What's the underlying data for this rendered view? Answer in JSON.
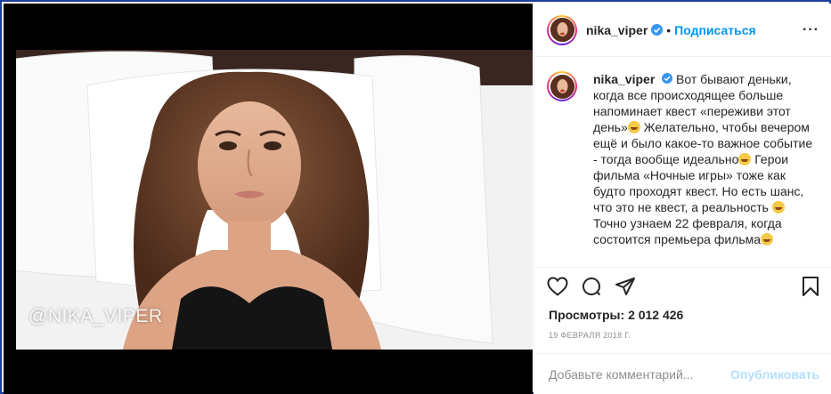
{
  "post": {
    "username": "nika_viper",
    "follow_label": "Подписаться",
    "separator": "•",
    "more_label": "···",
    "watermark": "@NIKA_VIPER",
    "caption_parts": [
      "Вот бывают деньки, когда все происходящее больше напоминает квест «переживи этот день»",
      "Желательно, чтобы вечером ещё и было какое-то важное событие - тогда вообще идеально",
      "Герои фильма «Ночные игры» тоже как будто проходят квест. Но есть шанс, что это не квест, а реальность ",
      " Точно узнаем 22 февраля, когда состоится премьера фильма"
    ],
    "views_label": "Просмотры:",
    "views_count": "2 012 426",
    "date": "19 февраля 2018 г.",
    "comment_placeholder": "Добавьте комментарий...",
    "publish_label": "Опубликовать"
  },
  "icons": {
    "verified": "verified-badge-icon",
    "like": "heart-icon",
    "comment": "comment-icon",
    "share": "share-icon",
    "save": "bookmark-icon"
  },
  "colors": {
    "accent": "#0095f6",
    "verified": "#3897f0",
    "publish_disabled": "#b2dffc",
    "muted": "#8e8e8e",
    "frame": "#1c3e9e"
  }
}
